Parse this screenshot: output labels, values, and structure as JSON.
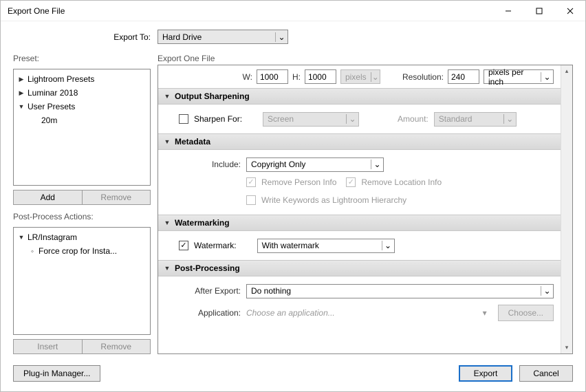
{
  "window": {
    "title": "Export One File"
  },
  "exportTo": {
    "label": "Export To:",
    "value": "Hard Drive"
  },
  "preset": {
    "label": "Preset:",
    "items": [
      {
        "label": "Lightroom Presets",
        "expanded": false
      },
      {
        "label": "Luminar 2018",
        "expanded": false
      },
      {
        "label": "User Presets",
        "expanded": true
      },
      {
        "label": "20m",
        "child": true
      }
    ],
    "addBtn": "Add",
    "removeBtn": "Remove"
  },
  "postProcessActions": {
    "label": "Post-Process Actions:",
    "items": [
      {
        "label": "LR/Instagram",
        "expanded": true
      },
      {
        "label": "Force crop for Insta...",
        "child": true
      }
    ],
    "insertBtn": "Insert",
    "removeBtn": "Remove"
  },
  "settings": {
    "title": "Export One File",
    "sizing": {
      "wLabel": "W:",
      "wValue": "1000",
      "hLabel": "H:",
      "hValue": "1000",
      "unit": "pixels",
      "resLabel": "Resolution:",
      "resValue": "240",
      "resUnit": "pixels per inch"
    },
    "sharpening": {
      "head": "Output Sharpening",
      "cbLabel": "Sharpen For:",
      "target": "Screen",
      "amountLabel": "Amount:",
      "amount": "Standard"
    },
    "metadata": {
      "head": "Metadata",
      "includeLabel": "Include:",
      "includeValue": "Copyright Only",
      "removePerson": "Remove Person Info",
      "removeLocation": "Remove Location Info",
      "writeKeywords": "Write Keywords as Lightroom Hierarchy"
    },
    "watermark": {
      "head": "Watermarking",
      "cbLabel": "Watermark:",
      "value": "With watermark"
    },
    "postprocessing": {
      "head": "Post-Processing",
      "afterLabel": "After Export:",
      "afterValue": "Do nothing",
      "appLabel": "Application:",
      "appPlaceholder": "Choose an application...",
      "chooseBtn": "Choose..."
    }
  },
  "footer": {
    "pluginManager": "Plug-in Manager...",
    "export": "Export",
    "cancel": "Cancel"
  }
}
